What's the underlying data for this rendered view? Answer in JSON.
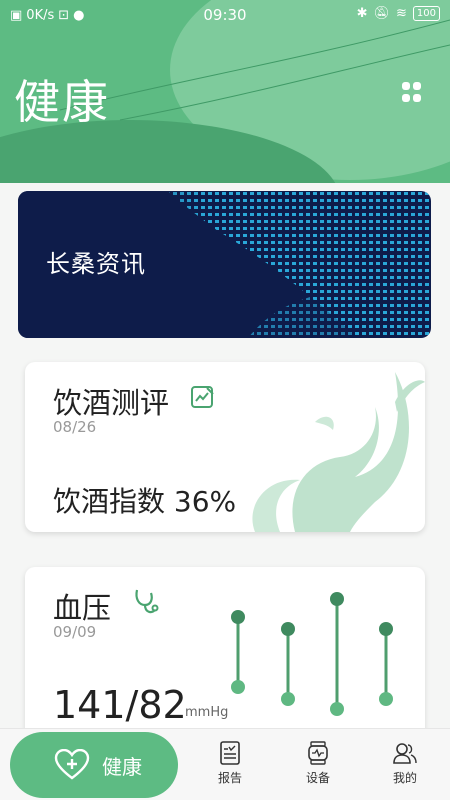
{
  "status_bar": {
    "speed": "0K/s",
    "time": "09:30",
    "battery": "100"
  },
  "header": {
    "title": "健康"
  },
  "banner": {
    "label": "长桑资讯"
  },
  "drink_card": {
    "title": "饮酒测评",
    "date": "08/26",
    "metric_label": "饮酒指数",
    "metric_value": "36%"
  },
  "bp_card": {
    "title": "血压",
    "date": "09/09",
    "value": "141/82",
    "unit": "mmHg"
  },
  "bottom_nav": {
    "health": "健康",
    "report": "报告",
    "device": "设备",
    "mine": "我的"
  },
  "colors": {
    "brand_green": "#5dbb83",
    "chart_green": "#3f8a5f",
    "banner_navy": "#0e1c4a"
  }
}
